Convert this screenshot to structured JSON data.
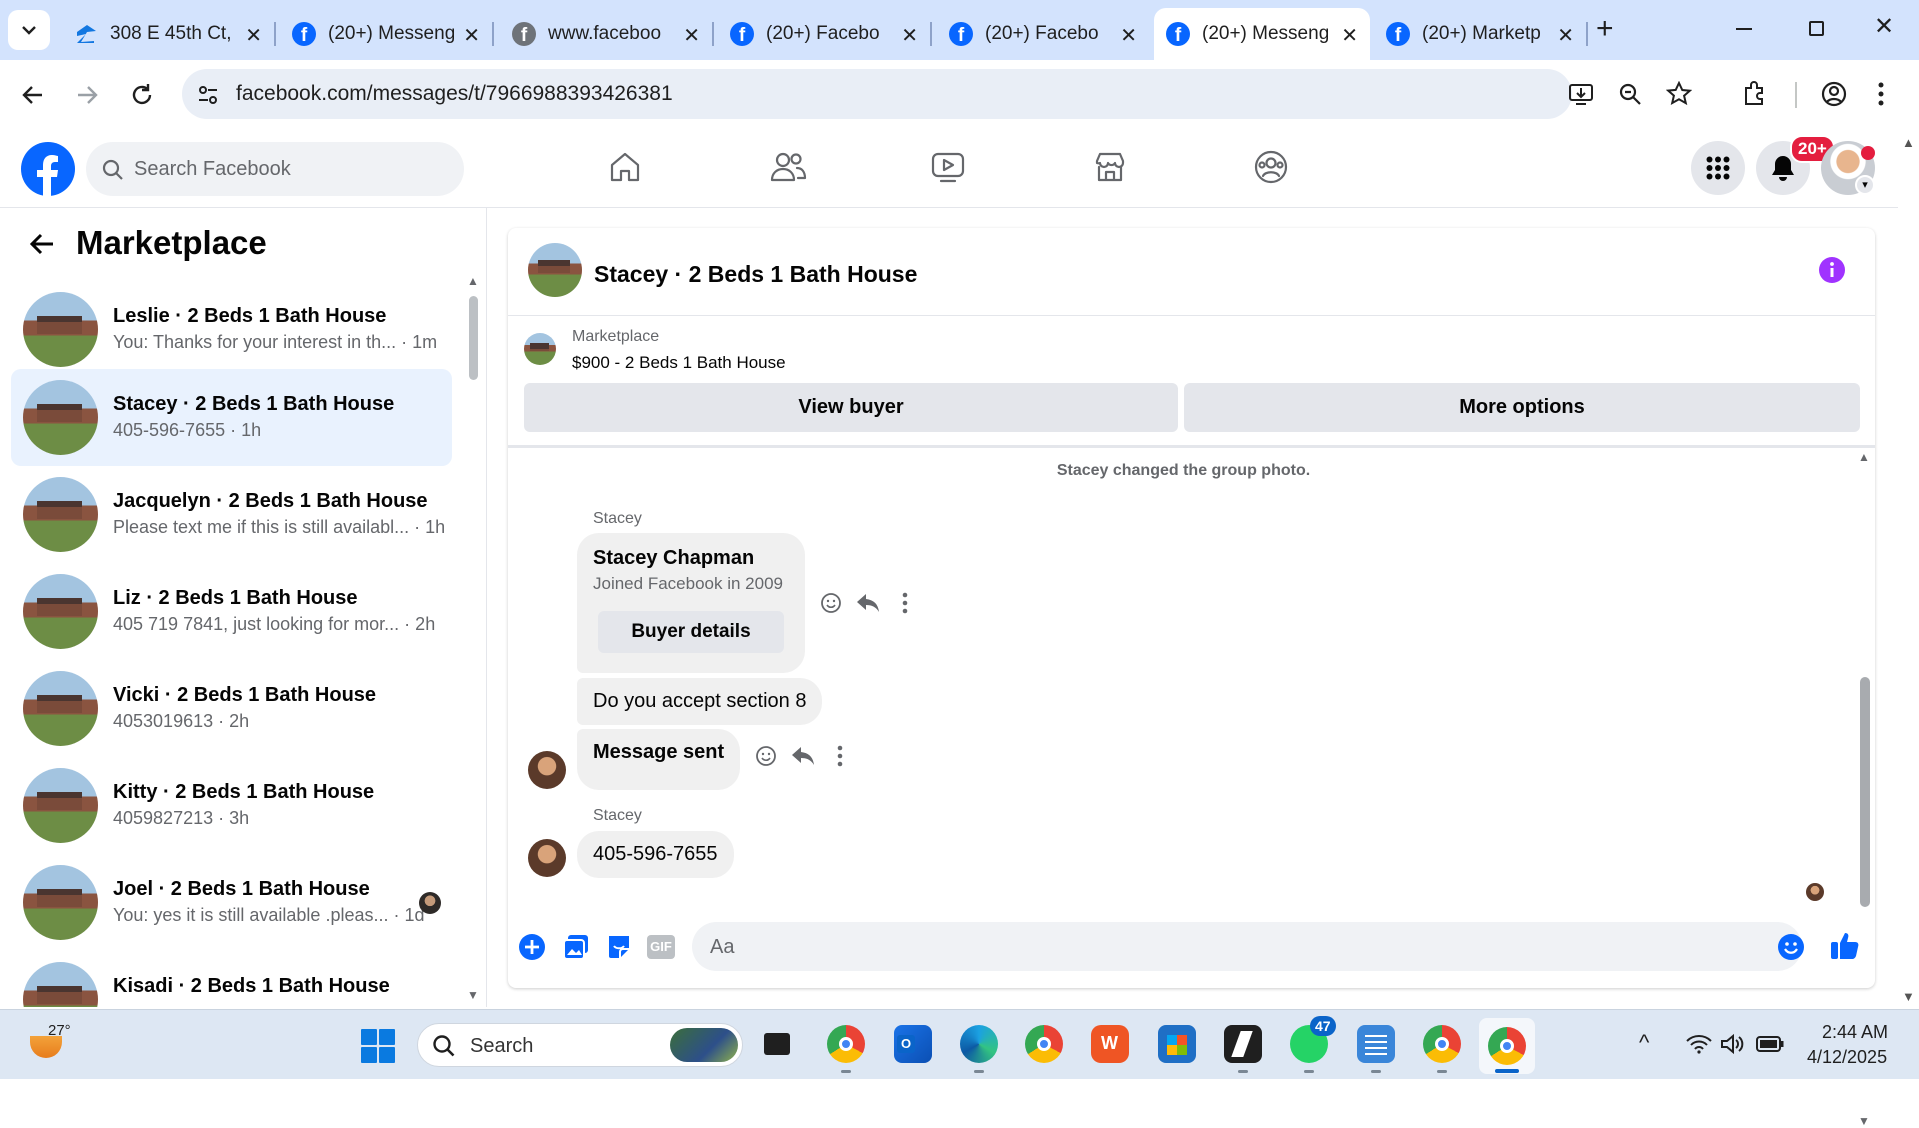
{
  "browser": {
    "tabs": [
      {
        "title": "308 E 45th Ct,",
        "icon": "zillow-icon"
      },
      {
        "title": "(20+) Messeng",
        "icon": "facebook-icon"
      },
      {
        "title": "www.faceboo",
        "icon": "facebook-grey-icon"
      },
      {
        "title": "(20+) Facebo",
        "icon": "facebook-icon"
      },
      {
        "title": "(20+) Facebo",
        "icon": "facebook-icon"
      },
      {
        "title": "(20+) Messeng",
        "icon": "facebook-icon",
        "active": true
      },
      {
        "title": "(20+) Marketp",
        "icon": "facebook-icon"
      }
    ],
    "url": "facebook.com/messages/t/7966988393426381"
  },
  "fb_header": {
    "search_placeholder": "Search Facebook",
    "notification_badge": "20+"
  },
  "sidebar": {
    "title": "Marketplace",
    "conversations": [
      {
        "name": "Leslie · 2 Beds 1 Bath House",
        "snippet": "You: Thanks for your interest in th... · 1m"
      },
      {
        "name": "Stacey · 2 Beds 1 Bath House",
        "snippet": "405-596-7655 · 1h",
        "selected": true
      },
      {
        "name": "Jacquelyn · 2 Beds 1 Bath House",
        "snippet": "Please text me if this is still availabl... · 1h"
      },
      {
        "name": "Liz · 2 Beds 1 Bath House",
        "snippet": "405 719 7841, just looking for mor... · 2h"
      },
      {
        "name": "Vicki · 2 Beds 1 Bath House",
        "snippet": "4053019613 · 2h"
      },
      {
        "name": "Kitty · 2 Beds 1 Bath House",
        "snippet": "4059827213 · 3h"
      },
      {
        "name": "Joel · 2 Beds 1 Bath House",
        "snippet": "You: yes it is still available .pleas... · 1d"
      },
      {
        "name": "Kisadi · 2 Beds 1 Bath House",
        "snippet": ""
      }
    ]
  },
  "chat": {
    "title": "Stacey · 2 Beds 1 Bath House",
    "listing_source": "Marketplace",
    "listing": "$900 - 2 Beds 1 Bath House",
    "view_buyer": "View buyer",
    "more_options": "More options",
    "system_message": "Stacey changed the group photo.",
    "sender1": "Stacey",
    "card_name": "Stacey Chapman",
    "card_sub": "Joined Facebook in 2009",
    "buyer_details": "Buyer details",
    "msg_section8": "Do you accept section 8",
    "msg_sent": "Message sent",
    "sender2": "Stacey",
    "msg_phone": "405-596-7655",
    "composer_placeholder": "Aa"
  },
  "taskbar": {
    "weather_temp": "27°",
    "search_label": "Search",
    "whatsapp_badge": "47",
    "time": "2:44 AM",
    "date": "4/12/2025"
  },
  "colors": {
    "facebook_blue": "#0866ff",
    "selected_row": "#e9f2fe",
    "tab_strip": "#d3e3fd"
  }
}
